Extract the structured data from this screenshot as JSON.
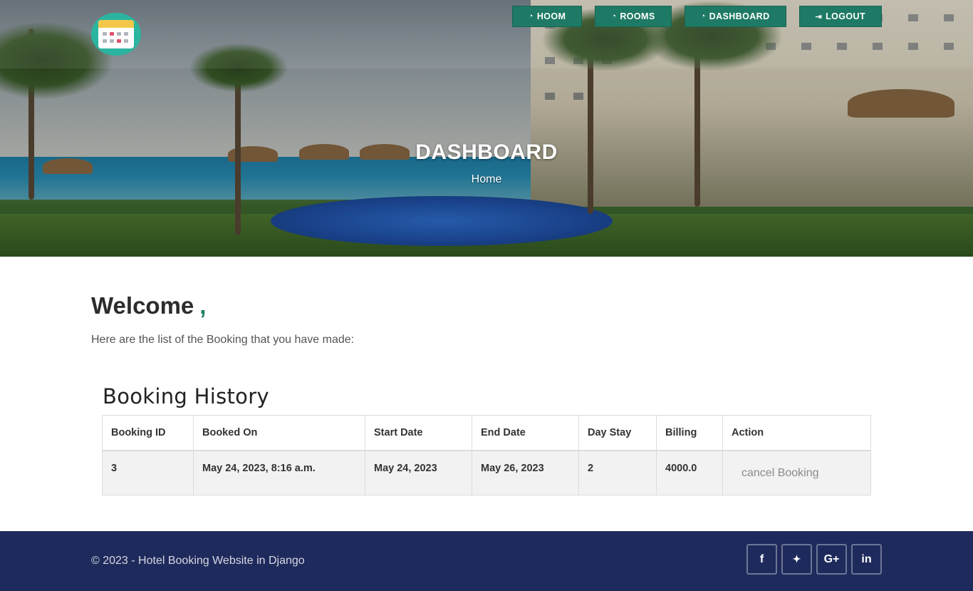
{
  "nav": {
    "items": [
      {
        "label": "HOOM",
        "icon": "dashboard-icon"
      },
      {
        "label": "ROOMS",
        "icon": "dashboard-icon"
      },
      {
        "label": "DASHBOARD",
        "icon": "dashboard-icon"
      },
      {
        "label": "LOGOUT",
        "icon": "logout-icon"
      }
    ]
  },
  "hero": {
    "title": "DASHBOARD",
    "breadcrumb": "Home"
  },
  "main": {
    "welcome": "Welcome",
    "welcome_suffix": ",",
    "intro": "Here are the list of the Booking that you have made:",
    "history_title": "Booking History"
  },
  "table": {
    "headers": [
      "Booking ID",
      "Booked On",
      "Start Date",
      "End Date",
      "Day Stay",
      "Billing",
      "Action"
    ],
    "rows": [
      {
        "id": "3",
        "booked_on": "May 24, 2023, 8:16 a.m.",
        "start": "May 24, 2023",
        "end": "May 26, 2023",
        "stay": "2",
        "billing": "4000.0",
        "action": "cancel Booking"
      }
    ]
  },
  "footer": {
    "copyright": "© 2023 - Hotel Booking Website in Django",
    "social": [
      {
        "icon": "facebook-icon",
        "glyph": "f"
      },
      {
        "icon": "twitter-icon",
        "glyph": "🐦"
      },
      {
        "icon": "google-plus-icon",
        "glyph": "G+"
      },
      {
        "icon": "linkedin-icon",
        "glyph": "in"
      }
    ]
  },
  "colors": {
    "accent": "#1e7a65",
    "footer_bg": "#1f2a5c"
  }
}
